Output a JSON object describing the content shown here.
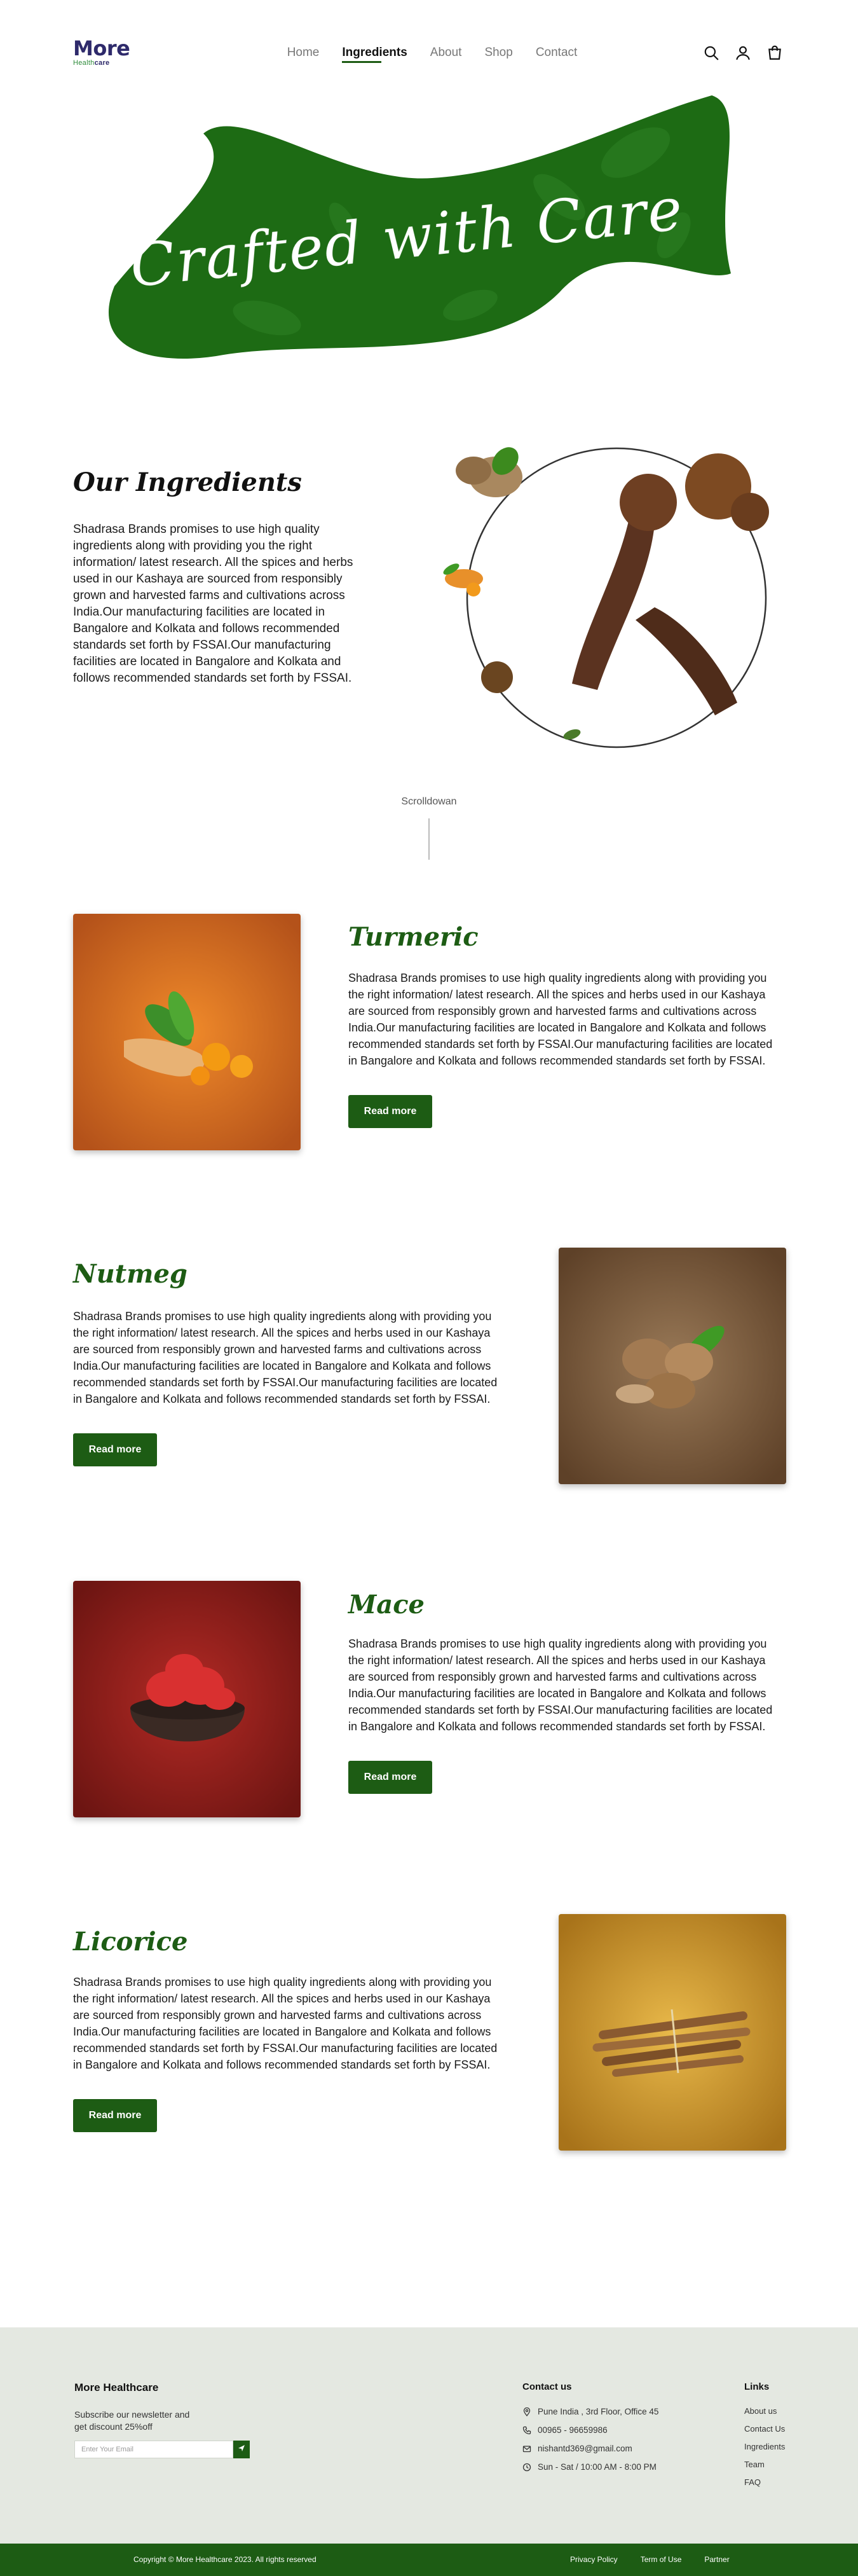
{
  "brand": {
    "logo_main": "More",
    "logo_sub_a": "Health",
    "logo_sub_b": "care"
  },
  "nav": {
    "items": [
      "Home",
      "Ingredients",
      "About",
      "Shop",
      "Contact"
    ],
    "active": "Ingredients"
  },
  "header_icons": [
    "search-icon",
    "user-icon",
    "bag-icon"
  ],
  "hero": {
    "title": "Crafted with Care"
  },
  "intro": {
    "title": "Our Ingredients",
    "text": "Shadrasa Brands promises to use high quality ingredients along with providing you the right information/ latest research. All the spices and herbs used in our Kashaya are sourced from responsibly grown and harvested farms and cultivations across India.Our manufacturing facilities are located in Bangalore and Kolkata and follows recommended standards set forth by FSSAI.Our manufacturing facilities are located in Bangalore and Kolkata and follows recommended standards set forth by FSSAI."
  },
  "scroll_label": "Scrolldowan",
  "ingredients": [
    {
      "title": "Turmeric",
      "text": "Shadrasa Brands promises to use high quality ingredients along with providing you the right information/ latest research. All the spices and herbs used in our Kashaya are sourced from responsibly grown and harvested farms and cultivations across India.Our manufacturing facilities are located in Bangalore and Kolkata and follows recommended standards set forth by FSSAI.Our manufacturing facilities are located in Bangalore and Kolkata and follows recommended standards set forth by FSSAI.",
      "button": "Read more"
    },
    {
      "title": "Nutmeg",
      "text": "Shadrasa Brands promises to use high quality ingredients along with providing you the right information/ latest research. All the spices and herbs used in our Kashaya are sourced from responsibly grown and harvested farms and cultivations across India.Our manufacturing facilities are located in Bangalore and Kolkata and follows recommended standards set forth by FSSAI.Our manufacturing facilities are located in Bangalore and Kolkata and follows recommended standards set forth by FSSAI.",
      "button": "Read more"
    },
    {
      "title": "Mace",
      "text": "Shadrasa Brands promises to use high quality ingredients along with providing you the right information/ latest research. All the spices and herbs used in our Kashaya are sourced from responsibly grown and harvested farms and cultivations across India.Our manufacturing facilities are located in Bangalore and Kolkata and follows recommended standards set forth by FSSAI.Our manufacturing facilities are located in Bangalore and Kolkata and follows recommended standards set forth by FSSAI.",
      "button": "Read more"
    },
    {
      "title": "Licorice",
      "text": "Shadrasa Brands promises to use high quality ingredients along with providing you the right information/ latest research. All the spices and herbs used in our Kashaya are sourced from responsibly grown and harvested farms and cultivations across India.Our manufacturing facilities are located in Bangalore and Kolkata and follows recommended standards set forth by FSSAI.Our manufacturing facilities are located in Bangalore and Kolkata and follows recommended standards set forth by FSSAI.",
      "button": "Read more"
    }
  ],
  "footer": {
    "brand": "More Healthcare",
    "newsletter": "Subscribe our newsletter and get discount 25%off",
    "email_placeholder": "Enter Your Email",
    "contact_title": "Contact us",
    "contact": [
      {
        "icon": "location-pin-icon",
        "text": "Pune India , 3rd Floor, Office 45"
      },
      {
        "icon": "phone-icon",
        "text": "00965 - 96659986"
      },
      {
        "icon": "mail-icon",
        "text": "nishantd369@gmail.com"
      },
      {
        "icon": "clock-icon",
        "text": "Sun - Sat / 10:00 AM - 8:00 PM"
      }
    ],
    "links_title": "Links",
    "links": [
      "About us",
      "Contact Us",
      "Ingredients",
      "Team",
      "FAQ"
    ],
    "copyright": "Copyright © More Healthcare 2023. All rights reserved",
    "legal": [
      "Privacy Policy",
      "Term of Use",
      "Partner"
    ]
  },
  "colors": {
    "primary_green": "#1d5c14",
    "footer_bg": "#e4e8e1"
  }
}
